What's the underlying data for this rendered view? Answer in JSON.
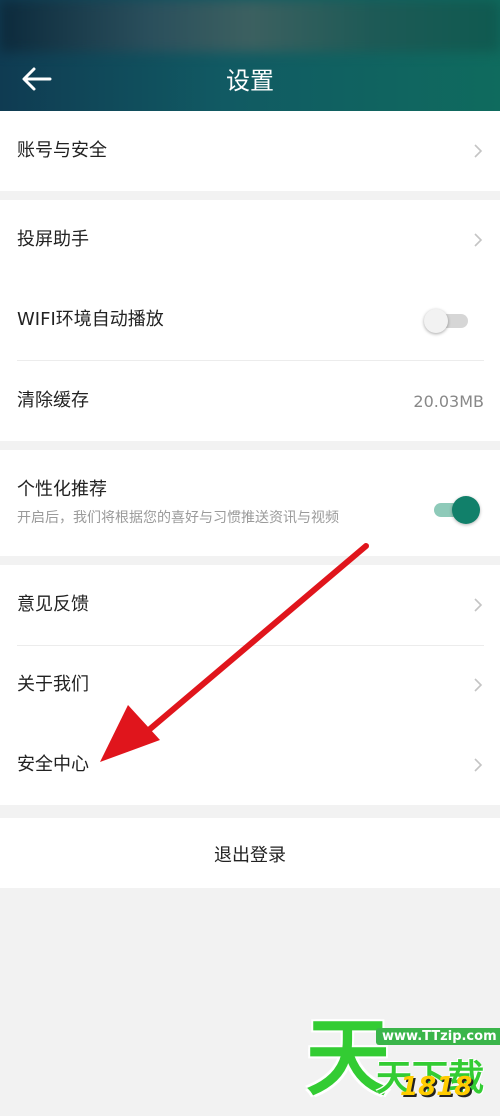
{
  "header": {
    "title": "设置",
    "back_icon": "arrow-left-icon"
  },
  "group1": {
    "items": [
      {
        "label": "账号与安全"
      }
    ]
  },
  "group2": {
    "items": [
      {
        "label": "投屏助手"
      },
      {
        "label": "WIFI环境自动播放",
        "toggle": "off"
      },
      {
        "label": "清除缓存",
        "value": "20.03MB"
      }
    ]
  },
  "group3": {
    "label": "个性化推荐",
    "description": "开启后，我们将根据您的喜好与习惯推送资讯与视频",
    "toggle": "on"
  },
  "group4": {
    "items": [
      {
        "label": "意见反馈"
      },
      {
        "label": "关于我们"
      },
      {
        "label": "安全中心"
      }
    ]
  },
  "logout": {
    "label": "退出登录"
  },
  "annotation": {
    "color": "#e0151c",
    "points_to": "安全中心"
  },
  "watermark": {
    "char": "天",
    "url": "www.TTzip.com",
    "text": "天下载",
    "number": "1818"
  },
  "colors": {
    "accent": "#11806a",
    "header": "#0f5a63",
    "background": "#f2f2f2"
  }
}
